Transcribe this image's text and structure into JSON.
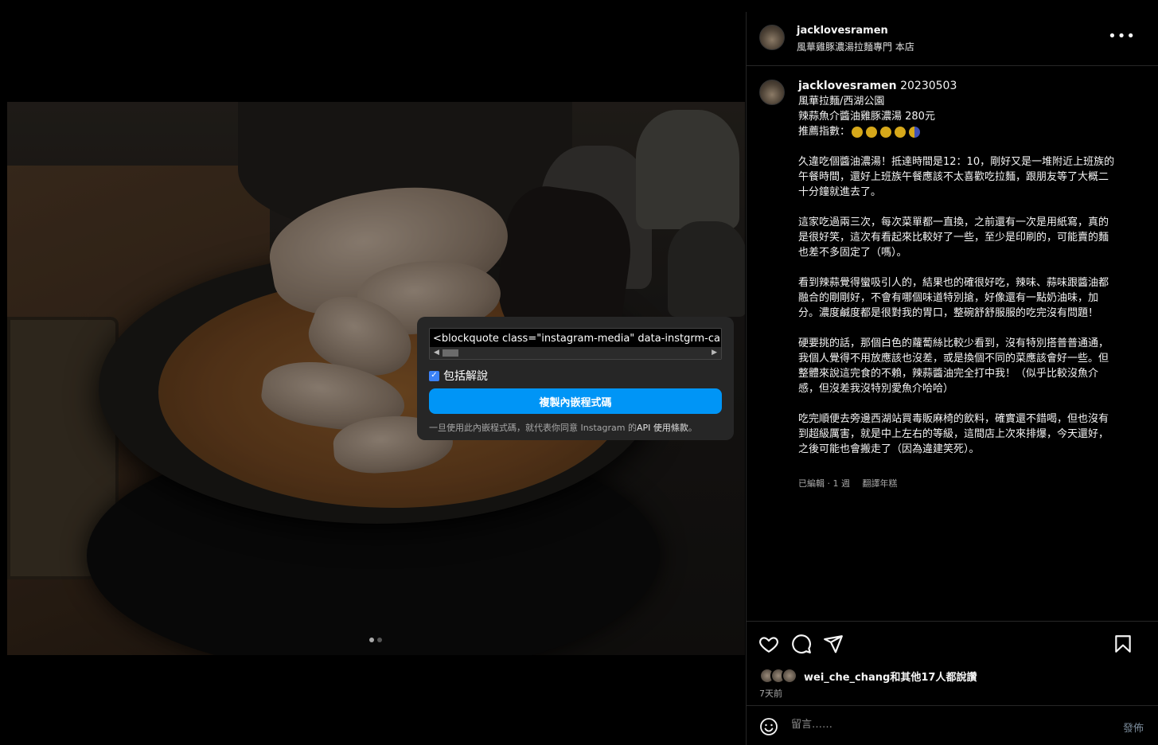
{
  "post": {
    "username": "jacklovesramen",
    "location": "風華雞豚濃湯拉麵專門 本店",
    "more_icon": "more-horizontal-icon"
  },
  "embed": {
    "code": "<blockquote class=\"instagram-media\" data-instgrm-captio",
    "include_caption_label": "包括解說",
    "include_caption_checked": true,
    "copy_button": "複製內嵌程式碼",
    "terms_prefix": "一旦使用此內嵌程式碼，就代表你同意 Instagram 的",
    "terms_link": "API 使用條款",
    "terms_suffix": "。"
  },
  "caption": {
    "username": "jacklovesramen",
    "head_date": " 20230503",
    "line1": "風華拉麵/西湖公園",
    "line2": "辣蒜魚介醬油雞豚濃湯 280元",
    "rating_label": "推薦指數：",
    "rating_value": 4.5,
    "rating_max": 5,
    "para1": "久違吃個醬油濃湯！抵達時間是12：10，剛好又是一堆附近上班族的午餐時間，還好上班族午餐應該不太喜歡吃拉麵，跟朋友等了大概二十分鐘就進去了。",
    "para2": "這家吃過兩三次，每次菜單都一直換，之前還有一次是用紙寫，真的是很好笑，這次有看起來比較好了一些，至少是印刷的，可能賣的麵也差不多固定了（嗎）。",
    "para3": "看到辣蒜覺得蠻吸引人的，結果也的確很好吃，辣味、蒜味跟醬油都融合的剛剛好，不會有哪個味道特別搶，好像還有一點奶油味，加分。濃度鹹度都是很對我的胃口，整碗舒舒服服的吃完沒有問題！",
    "para4": "硬要挑的話，那個白色的蘿蔔絲比較少看到，沒有特別搭普普通通，我個人覺得不用放應該也沒差，或是換個不同的菜應該會好一些。但整體來說這完食的不賴，辣蒜醬油完全打中我！（似乎比較沒魚介感，但沒差我沒特別愛魚介哈哈）",
    "para5": "吃完順便去旁邊西湖站買毒販麻椅的飲料，確實還不錯喝，但也沒有到超級厲害，就是中上左右的等級，這間店上次來排爆，今天還好，之後可能也會搬走了（因為違建笑死）。",
    "meta_edited": "已編輯 · 1 週",
    "meta_translate": "翻譯年糕"
  },
  "actions": {
    "like_icon": "heart-icon",
    "comment_icon": "comment-icon",
    "share_icon": "send-icon",
    "save_icon": "bookmark-icon",
    "likes_text": "wei_che_chang和其他17人都說讚",
    "time": "7天前"
  },
  "comment": {
    "placeholder": "留言……",
    "post_label": "發佈"
  },
  "carousel": {
    "count": 2,
    "active": 1
  },
  "colors": {
    "accent": "#0095f6",
    "background": "#000000",
    "popup": "#262626"
  }
}
